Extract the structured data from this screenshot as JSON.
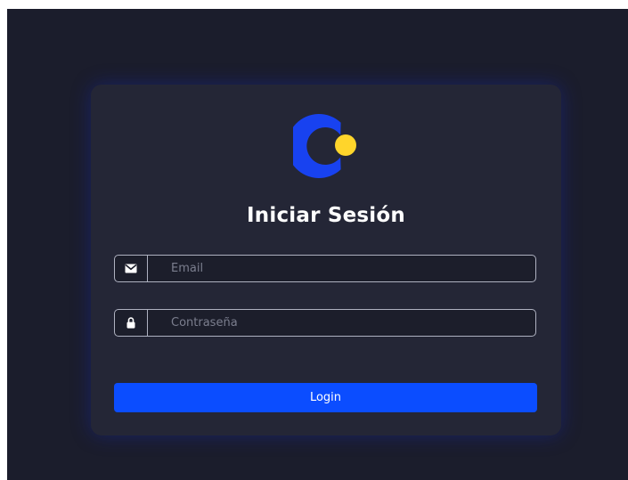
{
  "login": {
    "title": "Iniciar Sesión",
    "email": {
      "placeholder": "Email",
      "value": ""
    },
    "password": {
      "placeholder": "Contraseña",
      "value": ""
    },
    "submit_label": "Login"
  },
  "icons": {
    "logo": "brand-logo",
    "email": "envelope-icon",
    "password": "lock-icon"
  },
  "colors": {
    "page_background": "#1b1d2c",
    "card_background": "#242636",
    "accent": "#0b4dff",
    "logo_primary": "#1842f0",
    "logo_secondary": "#ffd52b"
  }
}
